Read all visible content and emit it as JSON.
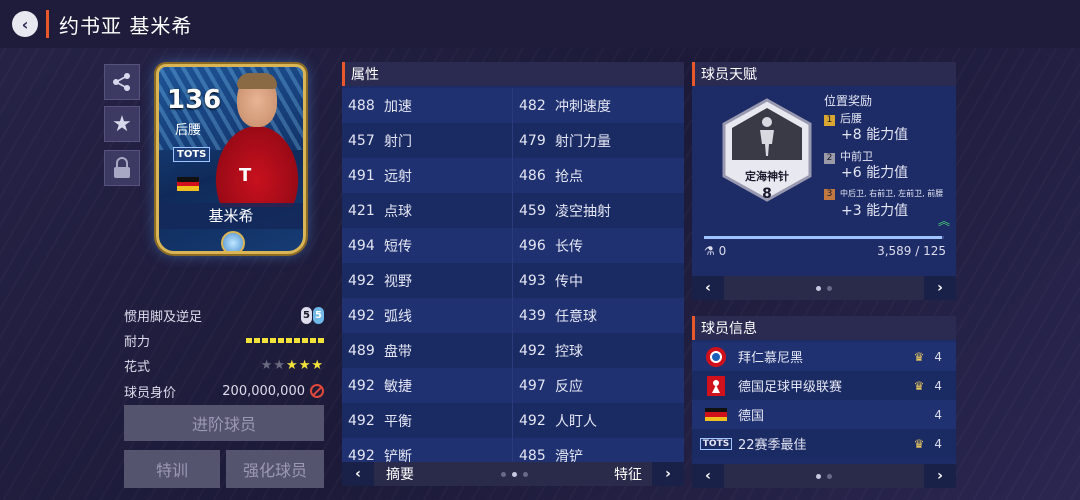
{
  "header": {
    "back_icon": "back-icon",
    "title": "约书亚 基米希"
  },
  "side_buttons": [
    "share-icon",
    "star-icon",
    "lock-icon"
  ],
  "card": {
    "rating": "136",
    "position": "后腰",
    "tots_label": "TOTS",
    "name": "基米希",
    "flag": [
      "#111111",
      "#d0101a",
      "#f0c020"
    ]
  },
  "profile": {
    "foot_label": "惯用脚及逆足",
    "foot_strong": "5",
    "foot_weak": "5",
    "stamina_label": "耐力",
    "stamina_bars": 10,
    "skill_label": "花式",
    "skill_stars": "★★★★★",
    "skill_filled": 3,
    "value_label": "球员身价",
    "value": "200,000,000"
  },
  "buttons": {
    "advance": "进阶球员",
    "train": "特训",
    "enhance": "强化球员"
  },
  "attributes": {
    "title": "属性",
    "rows": [
      [
        {
          "v": "488",
          "n": "加速"
        },
        {
          "v": "482",
          "n": "冲刺速度"
        }
      ],
      [
        {
          "v": "457",
          "n": "射门"
        },
        {
          "v": "479",
          "n": "射门力量"
        }
      ],
      [
        {
          "v": "491",
          "n": "远射"
        },
        {
          "v": "486",
          "n": "抢点"
        }
      ],
      [
        {
          "v": "421",
          "n": "点球"
        },
        {
          "v": "459",
          "n": "凌空抽射"
        }
      ],
      [
        {
          "v": "494",
          "n": "短传"
        },
        {
          "v": "496",
          "n": "长传"
        }
      ],
      [
        {
          "v": "492",
          "n": "视野"
        },
        {
          "v": "493",
          "n": "传中"
        }
      ],
      [
        {
          "v": "492",
          "n": "弧线"
        },
        {
          "v": "439",
          "n": "任意球"
        }
      ],
      [
        {
          "v": "489",
          "n": "盘带"
        },
        {
          "v": "492",
          "n": "控球"
        }
      ],
      [
        {
          "v": "492",
          "n": "敏捷"
        },
        {
          "v": "497",
          "n": "反应"
        }
      ],
      [
        {
          "v": "492",
          "n": "平衡"
        },
        {
          "v": "492",
          "n": "人盯人"
        }
      ],
      [
        {
          "v": "492",
          "n": "铲断"
        },
        {
          "v": "485",
          "n": "滑铲"
        }
      ]
    ],
    "footer_left": "摘要",
    "footer_right": "特征"
  },
  "talent": {
    "title": "球员天赋",
    "badge_text": "定海神针",
    "badge_level": "8",
    "bonus_title": "位置奖励",
    "bonuses": [
      {
        "idx": "1",
        "pos": "后腰",
        "value": "+8 能力值",
        "color": "#d9a632"
      },
      {
        "idx": "2",
        "pos": "中前卫",
        "value": "+6 能力值",
        "color": "#9a9aa8"
      },
      {
        "idx": "3",
        "pos": "中后卫, 右前卫, 左前卫, 前腰",
        "value": "+3 能力值",
        "color": "#c07840"
      }
    ],
    "progress_left": "0",
    "progress_right": "3,589 / 125",
    "progress_fraction": 0.99
  },
  "info": {
    "title": "球员信息",
    "rows": [
      {
        "icon": "bayern-icon",
        "name": "拜仁慕尼黑",
        "crown": true,
        "level": "4"
      },
      {
        "icon": "bundesliga-icon",
        "name": "德国足球甲级联赛",
        "crown": true,
        "level": "4"
      },
      {
        "icon": "germany-flag-icon",
        "name": "德国",
        "crown": false,
        "level": "4"
      },
      {
        "icon": "tots-icon",
        "name": "22赛季最佳",
        "crown": true,
        "level": "4"
      }
    ],
    "tots_icon_text": "TOTS"
  }
}
